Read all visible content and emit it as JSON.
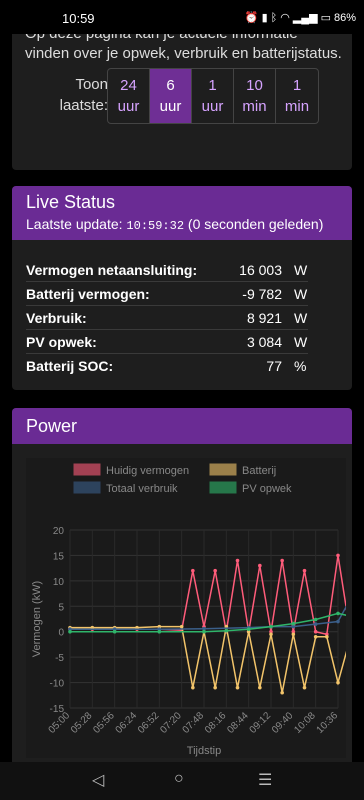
{
  "status_bar": {
    "time": "10:59",
    "battery": "86%"
  },
  "intro": {
    "text": "Op deze pagina kan je actuele informatie vinden over je opwek, verbruik en batterijstatus."
  },
  "range": {
    "label_line1": "Toon",
    "label_line2": "laatste:",
    "options": [
      {
        "num": "24",
        "unit": "uur",
        "active": false
      },
      {
        "num": "6",
        "unit": "uur",
        "active": true
      },
      {
        "num": "1",
        "unit": "uur",
        "active": false
      },
      {
        "num": "10",
        "unit": "min",
        "active": false
      },
      {
        "num": "1",
        "unit": "min",
        "active": false
      }
    ]
  },
  "live_status": {
    "title": "Live Status",
    "update_label": "Laatste update:",
    "update_time": "10:59:32",
    "update_ago": "(0 seconden geleden)",
    "rows": [
      {
        "label": "Vermogen netaansluiting:",
        "value": "16 003",
        "unit": "W"
      },
      {
        "label": "Batterij vermogen:",
        "value": "-9 782",
        "unit": "W"
      },
      {
        "label": "Verbruik:",
        "value": "8 921",
        "unit": "W"
      },
      {
        "label": "PV opwek:",
        "value": "3 084",
        "unit": "W"
      },
      {
        "label": "Batterij SOC:",
        "value": "77",
        "unit": "%"
      }
    ]
  },
  "power": {
    "title": "Power"
  },
  "colors": {
    "huidig": "#ff5c7a",
    "batterij": "#f2c46a",
    "totaal": "#3b5f8a",
    "pv": "#2fb56a",
    "accent": "#6a2b94"
  },
  "chart_data": {
    "type": "line",
    "ylabel": "Vermogen (kW)",
    "xlabel": "Tijdstip",
    "ylim": [
      -15,
      20
    ],
    "yticks": [
      "20",
      "15",
      "10",
      "5",
      "0",
      "-5",
      "-10",
      "-15"
    ],
    "xticks": [
      "05:00",
      "05:28",
      "05:56",
      "06:24",
      "06:52",
      "07:20",
      "07:48",
      "08:16",
      "08:44",
      "09:12",
      "09:40",
      "10:08",
      "10:36"
    ],
    "legend": [
      "Huidig vermogen",
      "Batterij",
      "Totaal verbruik",
      "PV opwek"
    ],
    "series": [
      {
        "name": "Huidig vermogen",
        "x": [
          0,
          1,
          2,
          3,
          4,
          5,
          5.5,
          6,
          6.5,
          7,
          7.5,
          8,
          8.5,
          9,
          9.5,
          10,
          10.5,
          11,
          11.5,
          12,
          12.5
        ],
        "values": [
          0.5,
          0.5,
          0.5,
          0.5,
          0.5,
          0.3,
          12,
          1,
          12,
          0,
          14,
          0,
          13,
          0,
          14,
          0,
          12,
          0,
          -0.5,
          15,
          1
        ]
      },
      {
        "name": "Batterij",
        "x": [
          0,
          1,
          2,
          3,
          4,
          5,
          5.5,
          6,
          6.5,
          7,
          7.5,
          8,
          8.5,
          9,
          9.5,
          10,
          10.5,
          11,
          11.5,
          12,
          12.5
        ],
        "values": [
          0.8,
          0.8,
          0.8,
          0.8,
          1,
          1,
          -11,
          0,
          -11,
          1,
          -11,
          0,
          -11,
          -0.5,
          -12,
          -0.5,
          -11,
          -1,
          -1,
          -10,
          -2
        ]
      },
      {
        "name": "Totaal verbruik",
        "x": [
          0,
          2,
          4,
          6,
          8,
          9,
          10,
          11,
          12,
          12.5
        ],
        "values": [
          0.5,
          0.5,
          0.5,
          0.6,
          0.8,
          1,
          1,
          1.5,
          2,
          6
        ]
      },
      {
        "name": "PV opwek",
        "x": [
          0,
          2,
          4,
          6,
          7,
          8,
          9,
          10,
          11,
          12,
          12.5
        ],
        "values": [
          0,
          0,
          0,
          0,
          0.2,
          0.5,
          1,
          1.6,
          2.4,
          3.6,
          3.1
        ]
      }
    ]
  }
}
